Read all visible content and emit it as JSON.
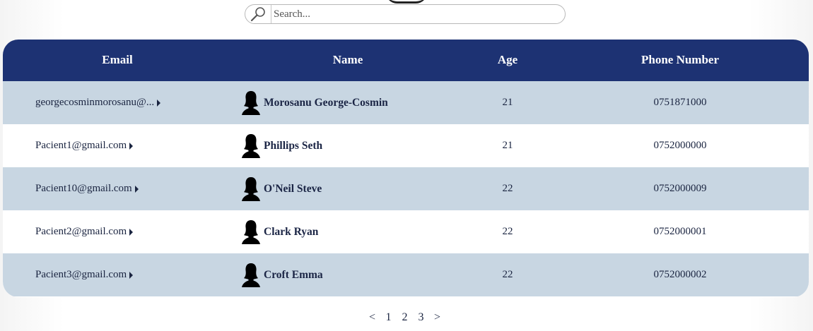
{
  "search": {
    "placeholder": "Search...",
    "value": ""
  },
  "table": {
    "columns": [
      "Email",
      "Name",
      "Age",
      "Phone Number"
    ],
    "rows": [
      {
        "email": "georgecosminmorosanu@...",
        "name": "Morosanu George-Cosmin",
        "age": "21",
        "phone": "0751871000"
      },
      {
        "email": "Pacient1@gmail.com",
        "name": "Phillips Seth",
        "age": "21",
        "phone": "0752000000"
      },
      {
        "email": "Pacient10@gmail.com",
        "name": "O'Neil Steve",
        "age": "22",
        "phone": "0752000009"
      },
      {
        "email": "Pacient2@gmail.com",
        "name": "Clark Ryan",
        "age": "22",
        "phone": "0752000001"
      },
      {
        "email": "Pacient3@gmail.com",
        "name": "Croft Emma",
        "age": "22",
        "phone": "0752000002"
      }
    ]
  },
  "pagination": {
    "prev": "<",
    "pages": [
      "1",
      "2",
      "3"
    ],
    "next": ">"
  },
  "colors": {
    "header_bg": "#1d3273",
    "row_shade": "#c8d6e2",
    "row_plain": "#ffffff"
  },
  "icons": {
    "search": "magnifier-icon",
    "avatar": "person-silhouette-icon",
    "row_expand": "caret-right-icon"
  }
}
